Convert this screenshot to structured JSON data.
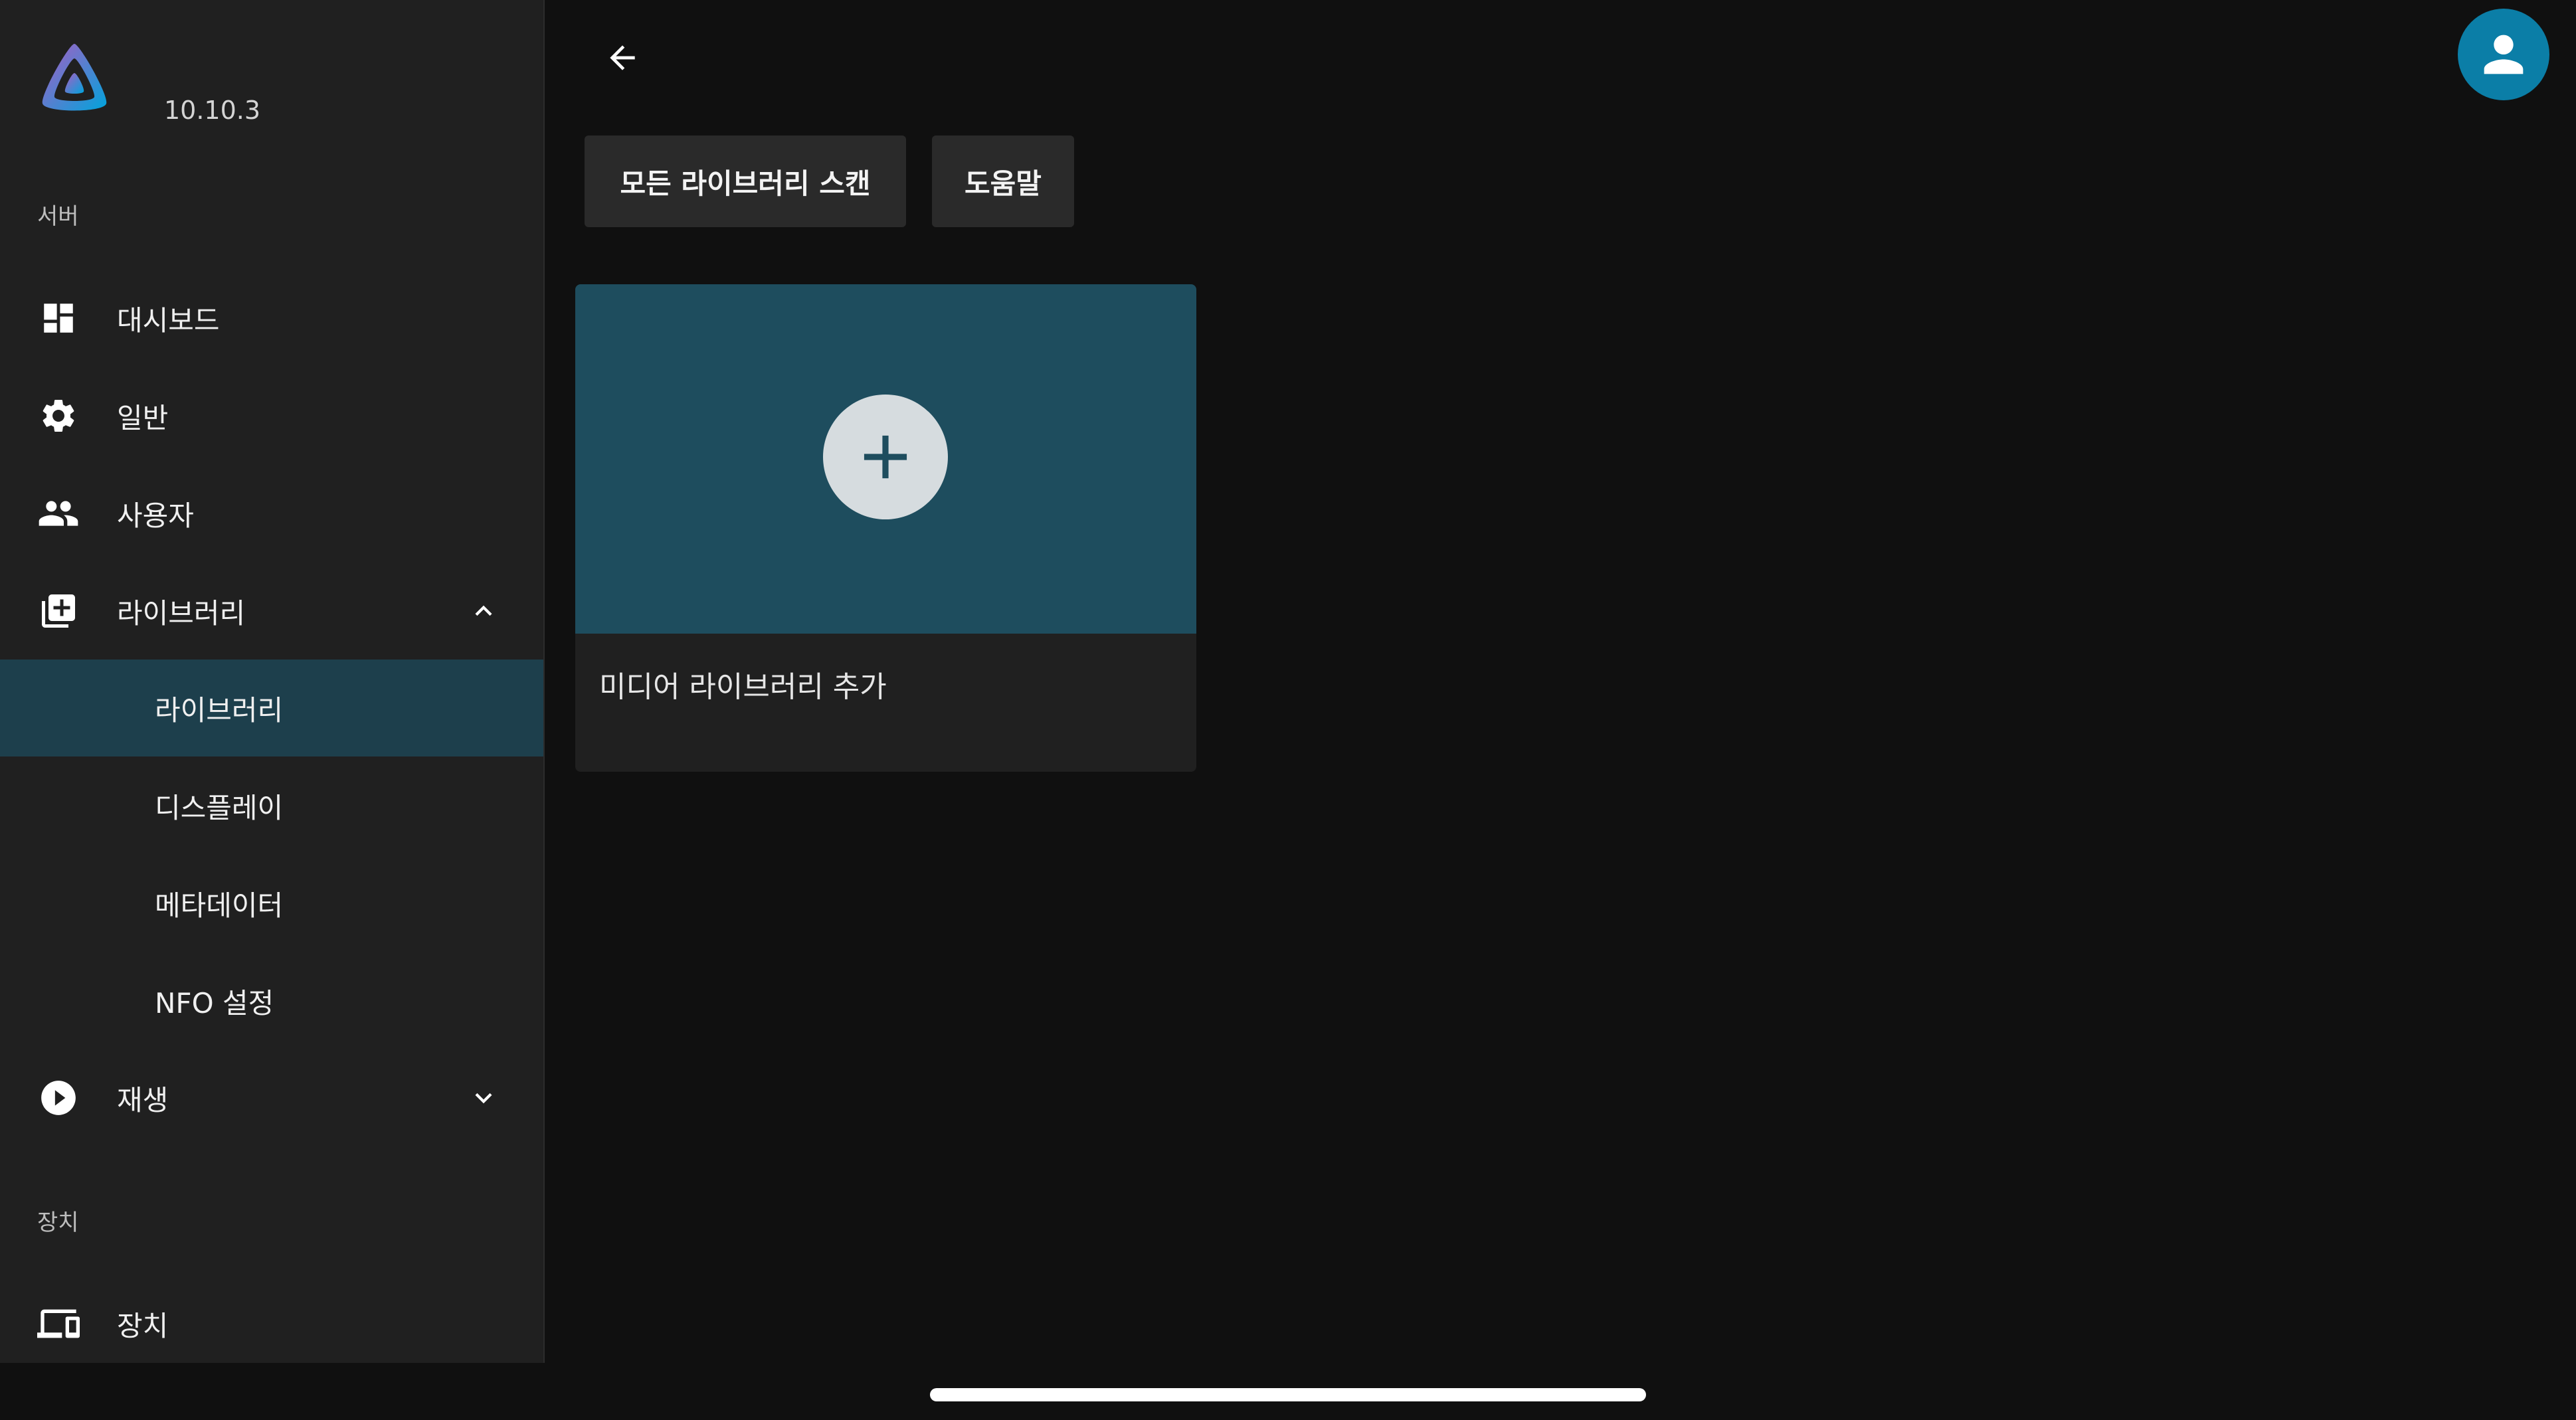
{
  "app": {
    "version": "10.10.3",
    "brand_colors": [
      "#7b43d6",
      "#1b8fe0"
    ]
  },
  "sidebar": {
    "sections": {
      "server": "서버",
      "devices": "장치"
    },
    "items": [
      {
        "label": "대시보드",
        "icon": "dashboard-icon"
      },
      {
        "label": "일반",
        "icon": "gear-icon"
      },
      {
        "label": "사용자",
        "icon": "people-icon"
      },
      {
        "label": "라이브러리",
        "icon": "library-add-icon",
        "expanded": true
      },
      {
        "label": "재생",
        "icon": "play-circle-icon",
        "expanded": false
      },
      {
        "label": "장치",
        "icon": "devices-icon"
      }
    ],
    "subitems": [
      {
        "label": "라이브러리",
        "active": true
      },
      {
        "label": "디스플레이"
      },
      {
        "label": "메타데이터"
      },
      {
        "label": "NFO 설정"
      }
    ]
  },
  "main": {
    "buttons": {
      "scan_all": "모든 라이브러리 스캔",
      "help": "도움말"
    },
    "card": {
      "label": "미디어 라이브러리 추가"
    }
  },
  "colors": {
    "accent_active": "#1d3f4c",
    "card_image": "#1e4d5e",
    "avatar": "#0b7ea7"
  }
}
